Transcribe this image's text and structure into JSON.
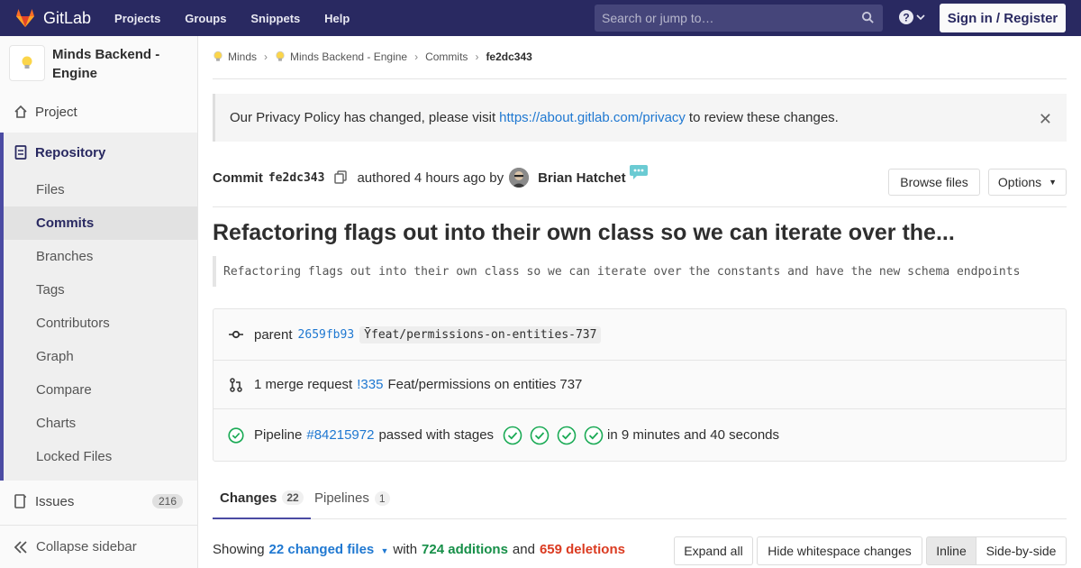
{
  "topbar": {
    "brand": "GitLab",
    "nav": [
      "Projects",
      "Groups",
      "Snippets",
      "Help"
    ],
    "search_placeholder": "Search or jump to…",
    "signin": "Sign in / Register"
  },
  "sidebar": {
    "project_title": "Minds Backend - Engine",
    "project": "Project",
    "repository": "Repository",
    "repo_items": [
      "Files",
      "Commits",
      "Branches",
      "Tags",
      "Contributors",
      "Graph",
      "Compare",
      "Charts",
      "Locked Files"
    ],
    "issues": "Issues",
    "issues_count": "216",
    "collapse": "Collapse sidebar"
  },
  "breadcrumb": {
    "items": [
      "Minds",
      "Minds Backend - Engine",
      "Commits",
      "fe2dc343"
    ]
  },
  "alert": {
    "before": "Our Privacy Policy has changed, please visit",
    "link": "https://about.gitlab.com/privacy",
    "after": "to review these changes."
  },
  "commit": {
    "label": "Commit",
    "sha": "fe2dc343",
    "authored": "authored 4 hours ago by",
    "author": "Brian Hatchet",
    "browse_files": "Browse files",
    "options": "Options",
    "title": "Refactoring flags out into their own class so we can iterate over the...",
    "description": "Refactoring flags out into their own class so we can iterate over the constants and have the new schema endpoints"
  },
  "info": {
    "parent_label": "parent",
    "parent_sha": "2659fb93",
    "branch": "feat/permissions-on-entities-737",
    "mr_text": "1 merge request",
    "mr_id": "!335",
    "mr_title": "Feat/permissions on entities 737",
    "pipeline_label": "Pipeline",
    "pipeline_id": "#84215972",
    "pipeline_status": "passed with stages",
    "pipeline_time": "in 9 minutes and 40 seconds"
  },
  "tabs": [
    {
      "label": "Changes",
      "count": "22"
    },
    {
      "label": "Pipelines",
      "count": "1"
    }
  ],
  "summary": {
    "showing": "Showing",
    "changed": "22 changed files",
    "with": "with",
    "additions": "724 additions",
    "and": "and",
    "deletions": "659 deletions"
  },
  "diff_buttons": {
    "expand": "Expand all",
    "whitespace": "Hide whitespace changes",
    "inline": "Inline",
    "side": "Side-by-side"
  },
  "colors": {
    "nav_bg": "#292961",
    "accent": "#4b4ba3",
    "link": "#1f78d1",
    "success": "#1aaa55",
    "deletion": "#db3b21"
  }
}
